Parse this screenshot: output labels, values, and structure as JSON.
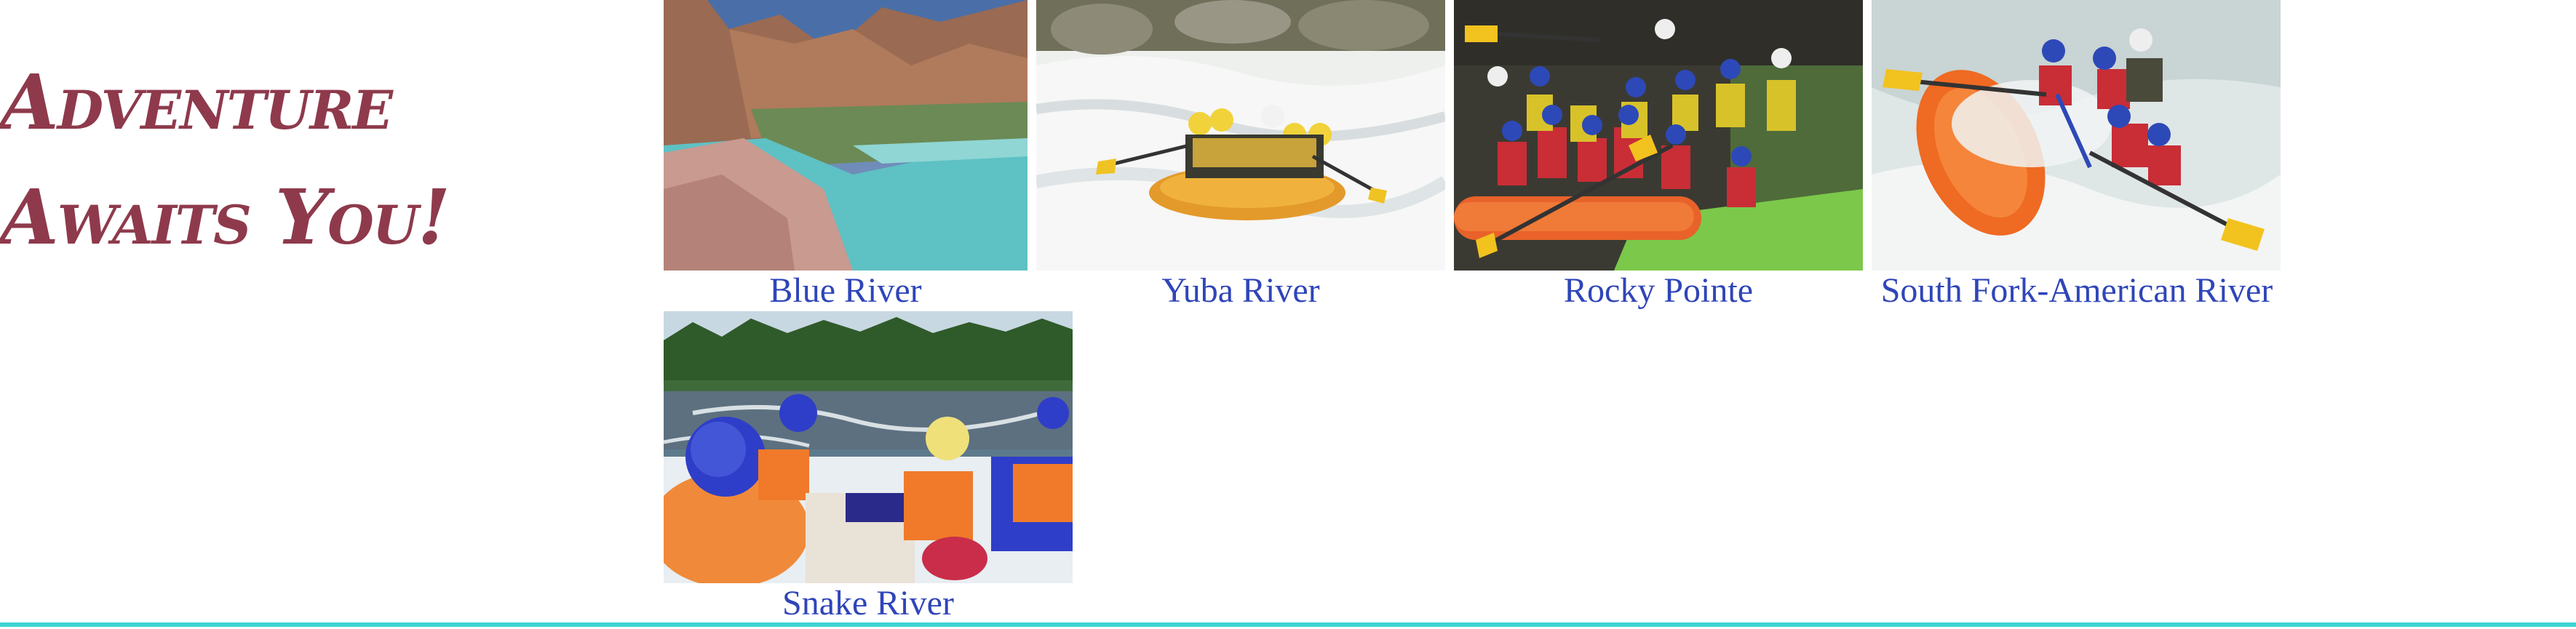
{
  "page": {
    "heading": "Adventure Awaits You!"
  },
  "trips": [
    {
      "name": "Blue River",
      "photo": "canyon-river-photo"
    },
    {
      "name": "Yuba River",
      "photo": "rafting-rapids-photo"
    },
    {
      "name": "Rocky Pointe",
      "photo": "rafting-group-photo"
    },
    {
      "name": "South Fork-American River",
      "photo": "rafting-splash-photo"
    },
    {
      "name": "Snake River",
      "photo": "rafting-river-view-photo"
    }
  ],
  "colors": {
    "heading": "#8e3a4c",
    "link": "#2f45b8",
    "rule": "#3fd3d3"
  }
}
